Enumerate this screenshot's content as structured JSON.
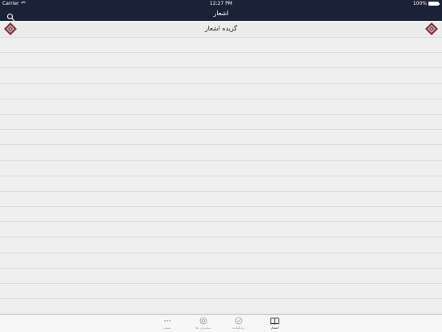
{
  "status_bar": {
    "carrier": "Carrier",
    "time": "12:27 PM",
    "battery": "100%",
    "battery_level": 1.0
  },
  "nav": {
    "title": "اشعار",
    "search_icon": "search-icon"
  },
  "section": {
    "title": "گزیده اشعار",
    "ornament_icon": "persian-ornament-icon"
  },
  "list": {
    "row_count": 18
  },
  "tabs": [
    {
      "label": "بیشتر",
      "icon": "more-dots-icon",
      "active": false
    },
    {
      "label": "سخنرانی ها",
      "icon": "speech-icon",
      "active": false
    },
    {
      "label": "زندگینامه",
      "icon": "biography-icon",
      "active": false
    },
    {
      "label": "اشعار",
      "icon": "book-icon",
      "active": true
    }
  ],
  "colors": {
    "bar": "#1b2237",
    "background": "#efeff0",
    "tab_inactive": "#9a9a9a"
  }
}
